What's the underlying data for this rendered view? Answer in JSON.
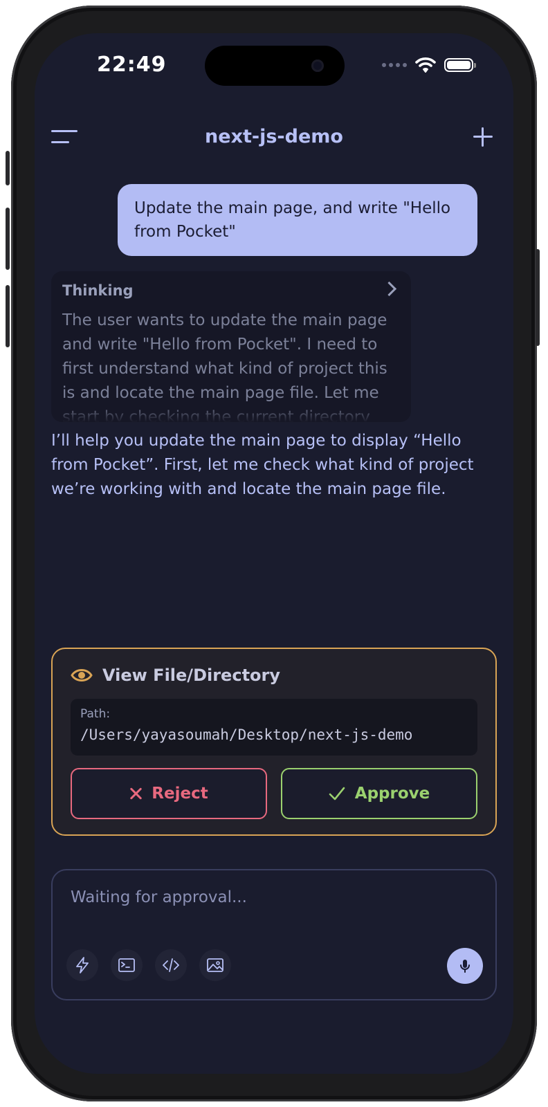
{
  "status_bar": {
    "time": "22:49"
  },
  "header": {
    "title": "next-js-demo"
  },
  "messages": {
    "user": "Update the main page, and write \"Hello from Pocket\"",
    "thinking": {
      "label": "Thinking",
      "text": "The user wants to update the main page and write \"Hello from Pocket\". I need to first understand what kind of project this is and locate the main page file. Let me start by checking the current directory structure."
    },
    "assistant": "I’ll help you update the main page to display “Hello from Pocket”. First, let me check what kind of project we’re working with and locate the main page file."
  },
  "approval": {
    "icon": "eye-icon",
    "title": "View File/Directory",
    "path_label": "Path:",
    "path_value": "/Users/yayasoumah/Desktop/next-js-demo",
    "reject_label": "Reject",
    "approve_label": "Approve"
  },
  "composer": {
    "placeholder": "Waiting for approval...",
    "tools": [
      "lightning-icon",
      "terminal-icon",
      "code-icon",
      "image-icon"
    ],
    "mic_icon": "microphone-icon"
  },
  "colors": {
    "background": "#1a1c2e",
    "accent": "#b3bcf4",
    "warning_border": "#d9a455",
    "reject": "#e8697f",
    "approve": "#9bd16f"
  }
}
